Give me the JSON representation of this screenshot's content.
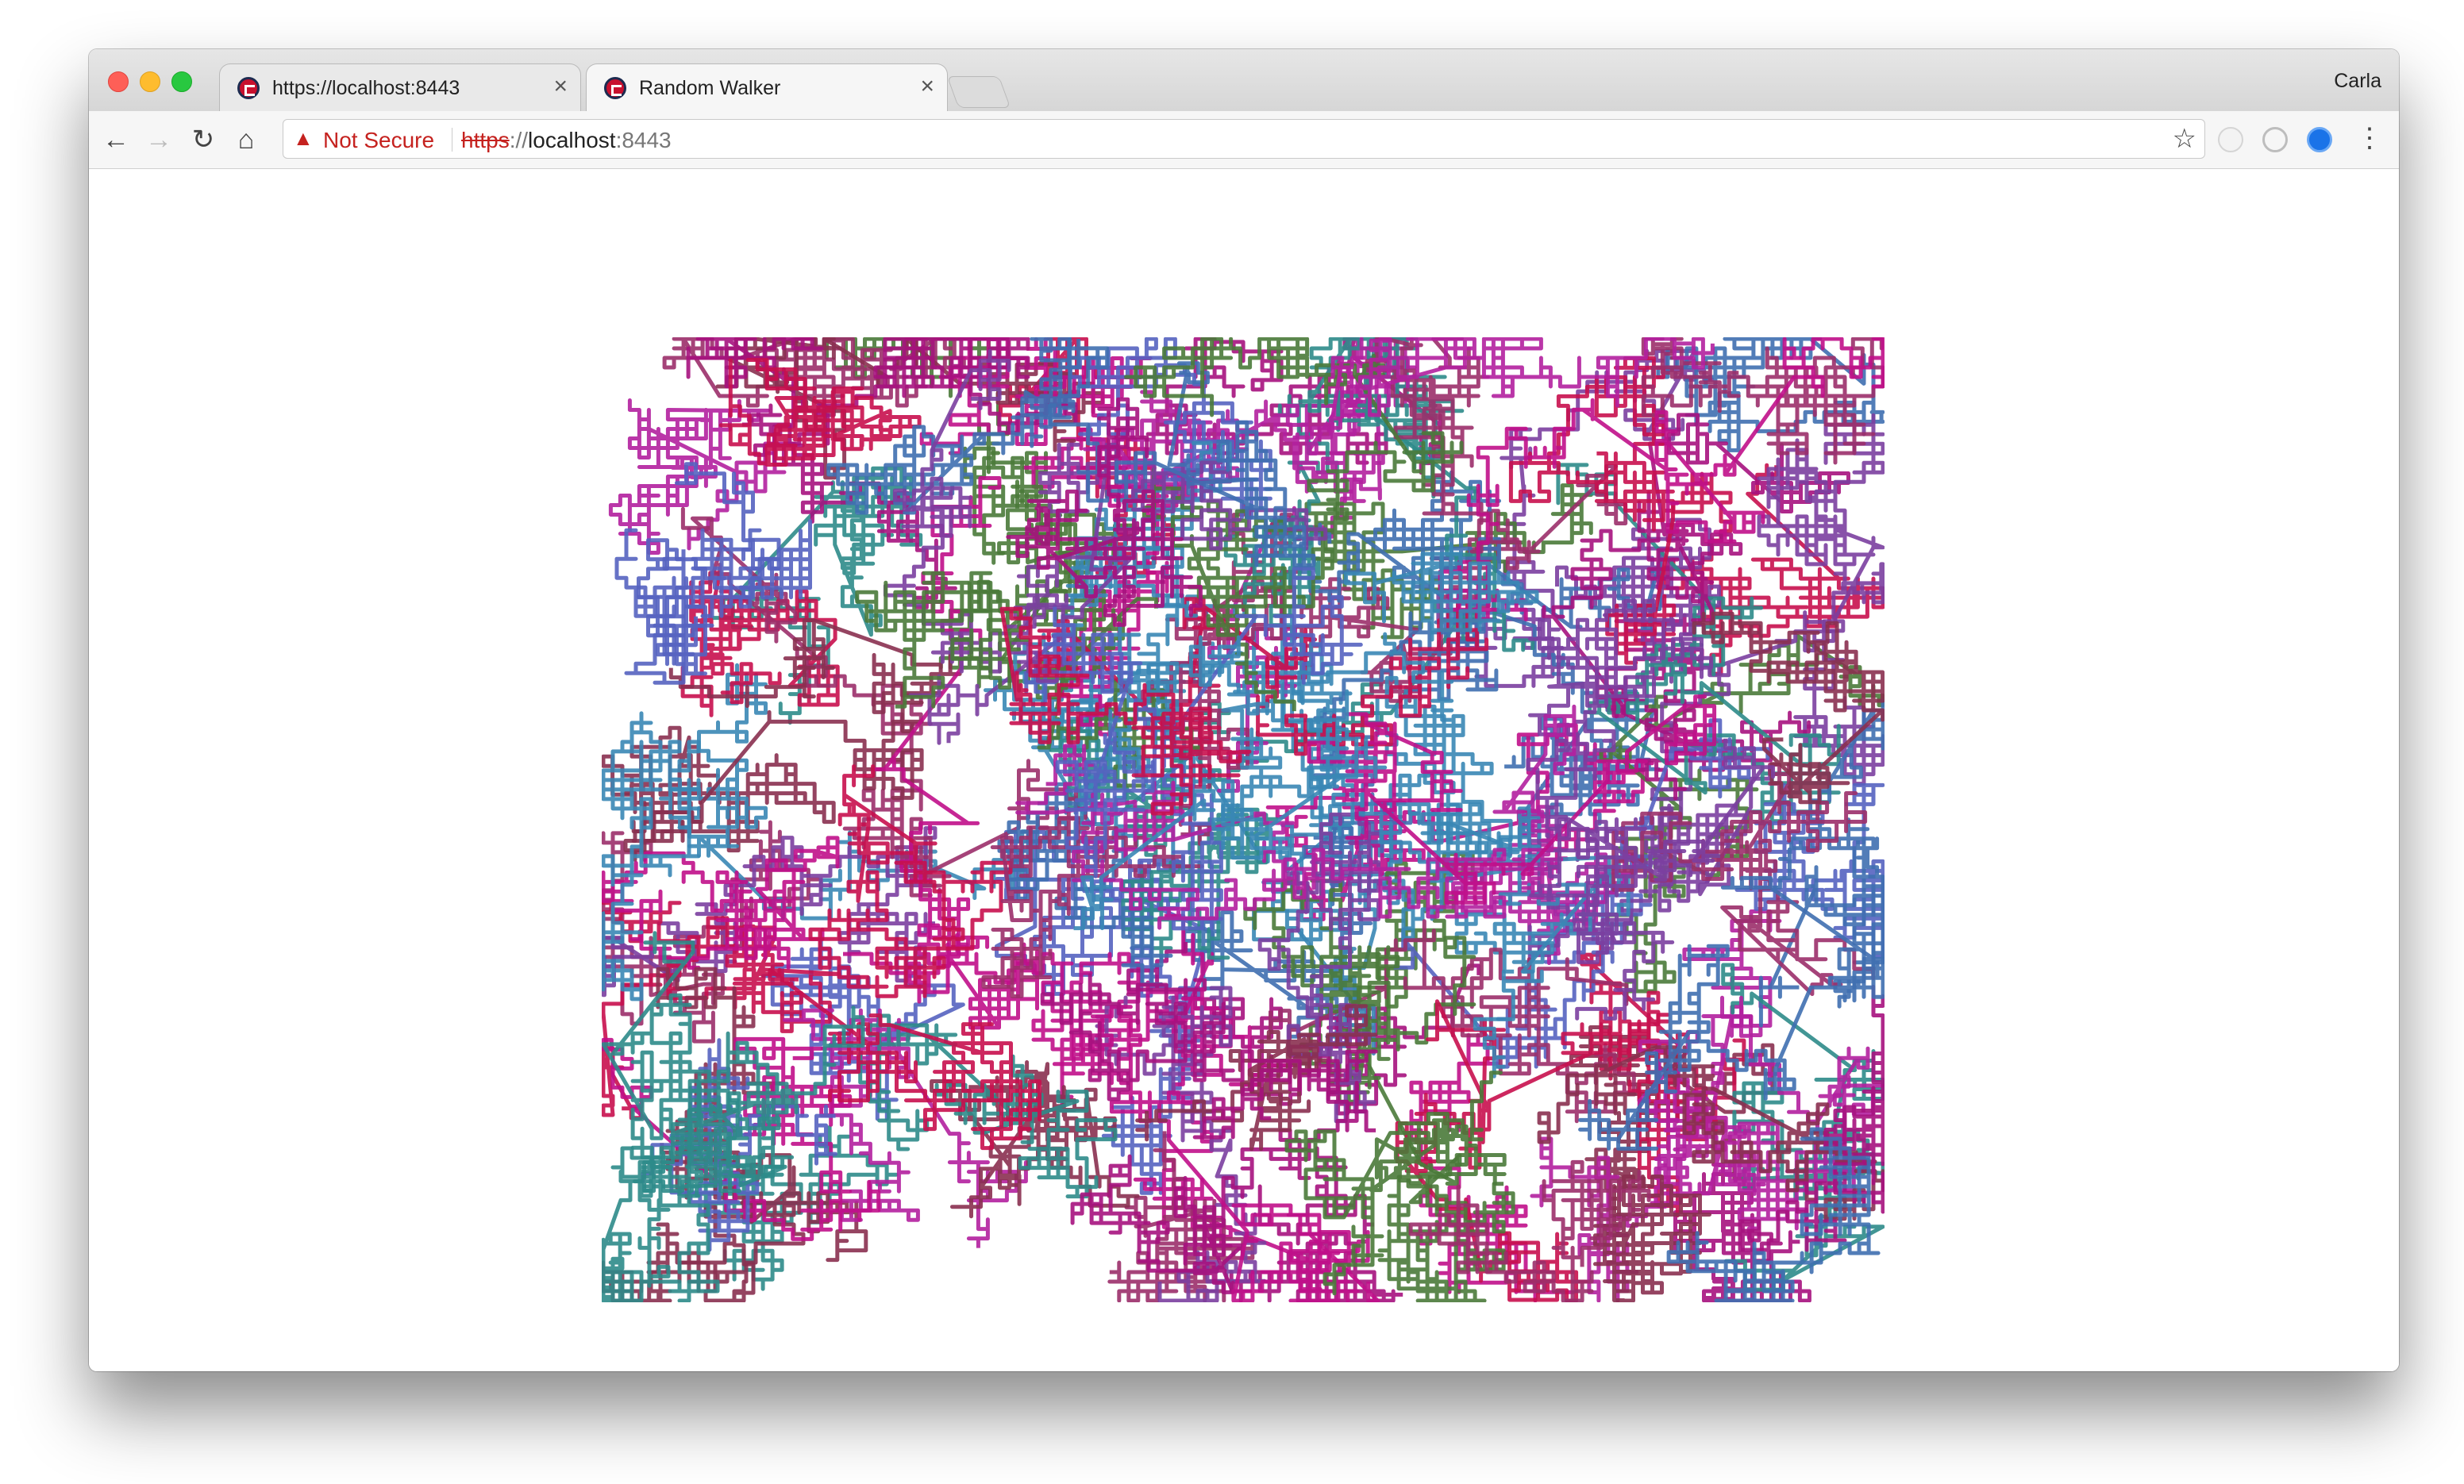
{
  "tabs": [
    {
      "title": "https://localhost:8443",
      "close": "×"
    },
    {
      "title": "Random Walker",
      "close": "×"
    }
  ],
  "profile_name": "Carla",
  "toolbar": {
    "back_icon": "arrow-left-icon",
    "forward_icon": "arrow-right-icon",
    "reload_icon": "reload-icon",
    "home_icon": "home-icon"
  },
  "omnibox": {
    "security_label": "Not Secure",
    "url_scheme": "https",
    "url_separator": "://",
    "url_host": "localhost",
    "url_port": ":8443"
  },
  "colors": {
    "walkers": [
      "#a6127e",
      "#c0108a",
      "#3a87b5",
      "#2e8b8a",
      "#4a7a3a",
      "#c8104e",
      "#7b3fa0",
      "#9b2f6a",
      "#5563c0",
      "#b3209e",
      "#8a3050",
      "#3f6fb0"
    ]
  }
}
